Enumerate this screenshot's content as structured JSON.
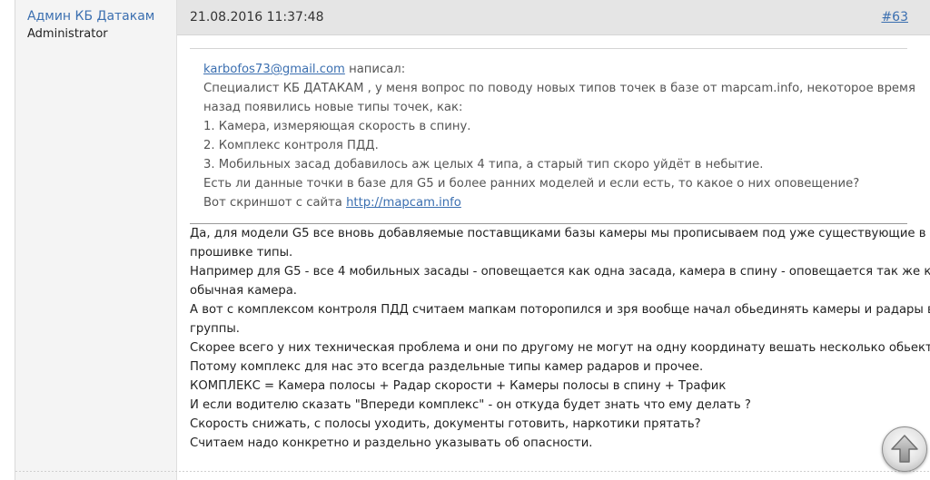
{
  "author": {
    "name": "Админ КБ Датакам",
    "role": "Administrator"
  },
  "post": {
    "date": "21.08.2016 11:37:48",
    "number": "#63"
  },
  "quote": {
    "author": "karbofos73@gmail.com",
    "wrote": " написал:",
    "lines": [
      "Специалист КБ ДАТАКАМ , у меня вопрос по поводу новых типов точек в базе от mapcam.info, некоторое время",
      "назад появились новые типы точек, как:",
      "1. Камера, измеряющая скорость в спину.",
      "2. Комплекс контроля ПДД.",
      "3. Мобильных засад добавилось аж целых 4 типа, а старый тип скоро уйдёт в небытие.",
      "Есть ли данные точки в базе для G5 и более ранних моделей и если есть, то какое о них оповещение?"
    ],
    "screenshot_prefix": "Вот скриншот с сайта ",
    "screenshot_link": "http://mapcam.info"
  },
  "reply": {
    "lines": [
      "Да, для модели G5 все вновь добавляемые поставщиками базы камеры мы прописываем под уже существующие в",
      "прошивке типы.",
      "Например для G5 - все 4 мобильных засады - оповещается как одна засада, камера в спину - оповещается так же как",
      "обычная камера.",
      "А вот с комплексом контроля ПДД считаем мапкам поторопился и зря вообще начал обьединять камеры и радары в",
      "группы.",
      "Скорее всего у них техническая проблема и они по другому не могут на одну координату вешать несколько обьектов.",
      "Потому комплекс для нас это всегда раздельные типы камер радаров и прочее.",
      "КОМПЛЕКС = Камера полосы + Радар скорости + Камеры полосы в спину + Трафик",
      "И если водителю сказать \"Впереди комплекс\" - он откуда будет знать что ему делать ?",
      "Скорость снижать, с полосы уходить, документы готовить, наркотики прятать?",
      "Считаем надо конкретно и раздельно указывать об опасности."
    ]
  },
  "icons": {
    "scroll_top": "arrow-up-icon"
  }
}
